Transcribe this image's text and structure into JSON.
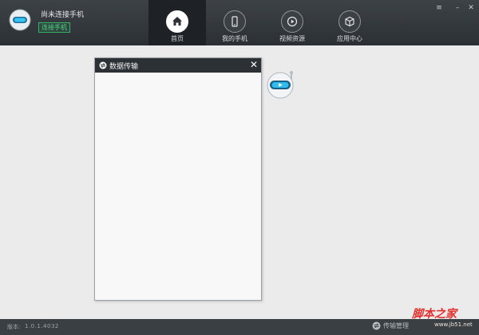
{
  "header": {
    "status_text": "尚未连接手机",
    "connect_button": "连接手机",
    "nav": [
      {
        "label": "首页",
        "icon": "home-icon",
        "active": true
      },
      {
        "label": "我的手机",
        "icon": "phone-icon",
        "active": false
      },
      {
        "label": "视频资源",
        "icon": "video-icon",
        "active": false
      },
      {
        "label": "应用中心",
        "icon": "cube-icon",
        "active": false
      }
    ]
  },
  "window_controls": {
    "menu": "≡",
    "minimize": "–",
    "close": "✕"
  },
  "dialog": {
    "title": "数据传输",
    "close": "✕"
  },
  "footer": {
    "version_label": "版本:",
    "version_value": "1.0.1.4032",
    "transfer_label": "传输管理"
  },
  "watermark": {
    "main": "脚本之家",
    "sub": "www.jb51.net"
  },
  "colors": {
    "header_bg": "#33383d",
    "accent_green": "#35b36b",
    "robot_eye": "#27b6e8",
    "watermark_red": "#e3312d"
  }
}
